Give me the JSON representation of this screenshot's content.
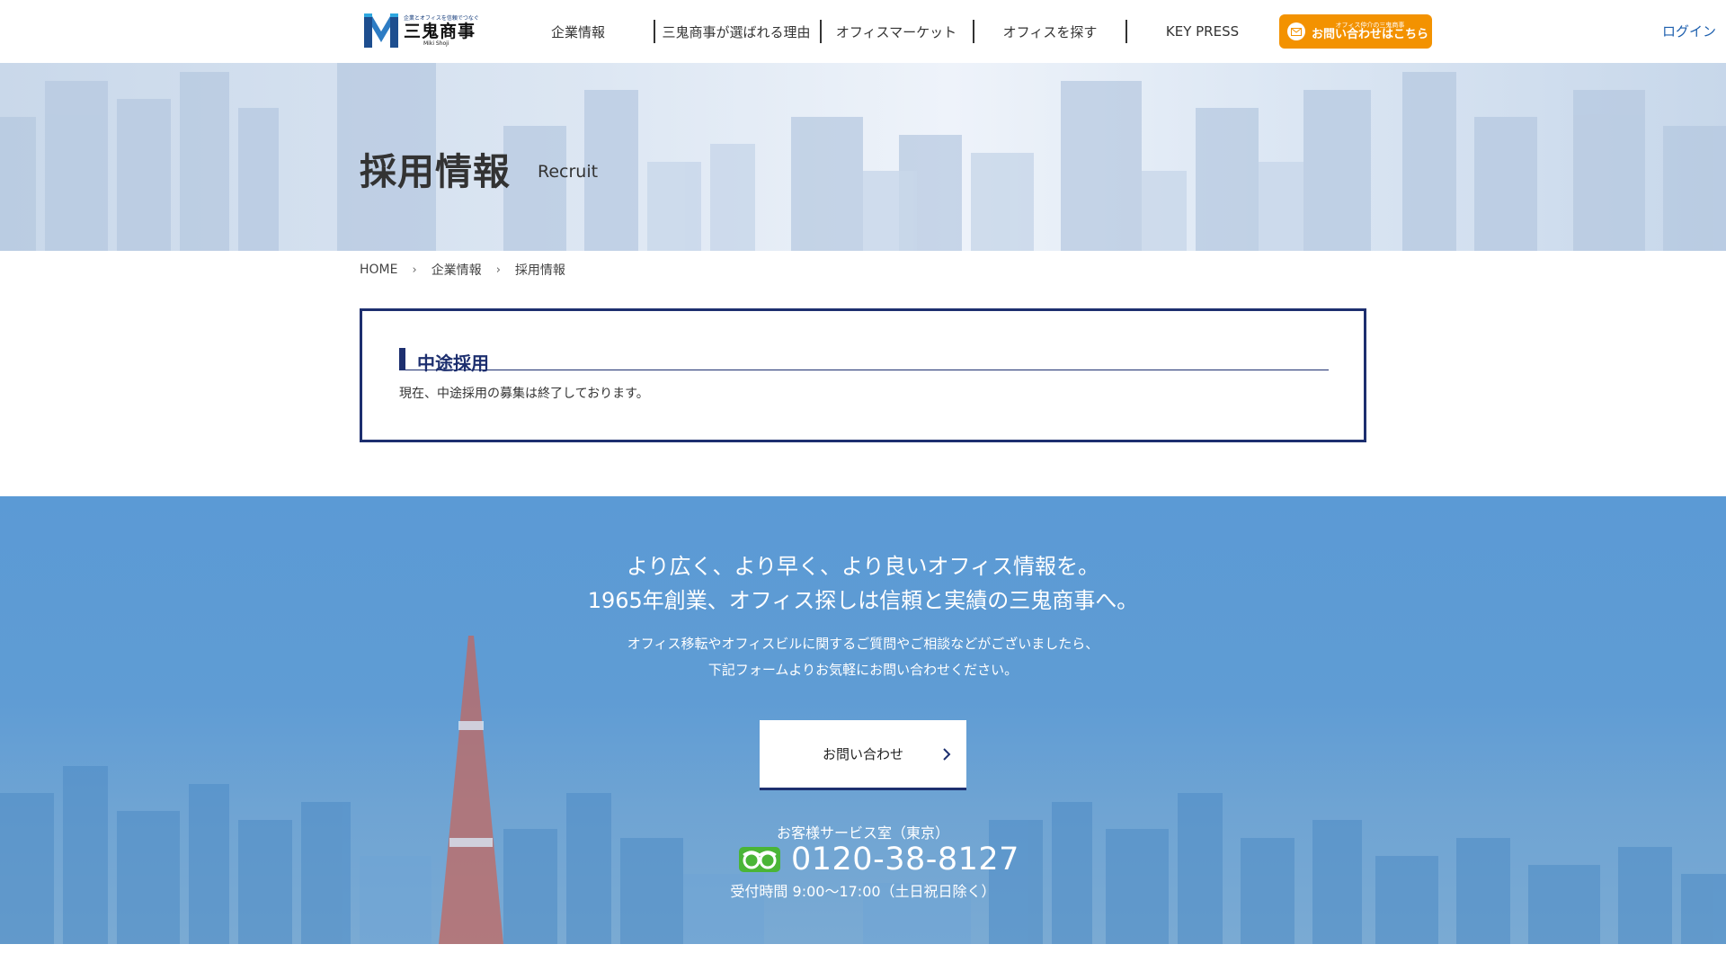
{
  "header": {
    "logo": {
      "tagline": "企業とオフィスを信頼でつなぐ",
      "name": "三鬼商事",
      "sub": "Miki Shoji"
    },
    "nav": [
      "企業情報",
      "三鬼商事が選ばれる理由",
      "オフィスマーケット",
      "オフィスを探す",
      "KEY PRESS"
    ],
    "contact_button": {
      "small": "オフィス仲介の三鬼商事",
      "main": "お問い合わせはこちら"
    },
    "login": "ログイン"
  },
  "hero": {
    "title": "採用情報",
    "subtitle": "Recruit"
  },
  "breadcrumb": [
    "HOME",
    "企業情報",
    "採用情報"
  ],
  "section": {
    "title": "中途採用",
    "body": "現在、中途採用の募集は終了しております。"
  },
  "cta": {
    "headline_1": "より広く、より早く、より良いオフィス情報を。",
    "headline_2": "1965年創業、オフィス探しは信頼と実績の三鬼商事へ。",
    "text_1": "オフィス移転やオフィスビルに関するご質問やご相談などがございましたら、",
    "text_2": "下記フォームよりお気軽にお問い合わせください。",
    "button": "お問い合わせ",
    "tel_label": "お客様サービス室（東京）",
    "tel_number": "0120-38-8127",
    "tel_hours": "受付時間 9:00〜17:00（土日祝日除く）"
  },
  "colors": {
    "navy": "#1d2f6f",
    "orange": "#f39200",
    "link_blue": "#1d5fae",
    "cta_blue": "#5f9cd4",
    "freedial_green": "#4ab536"
  }
}
